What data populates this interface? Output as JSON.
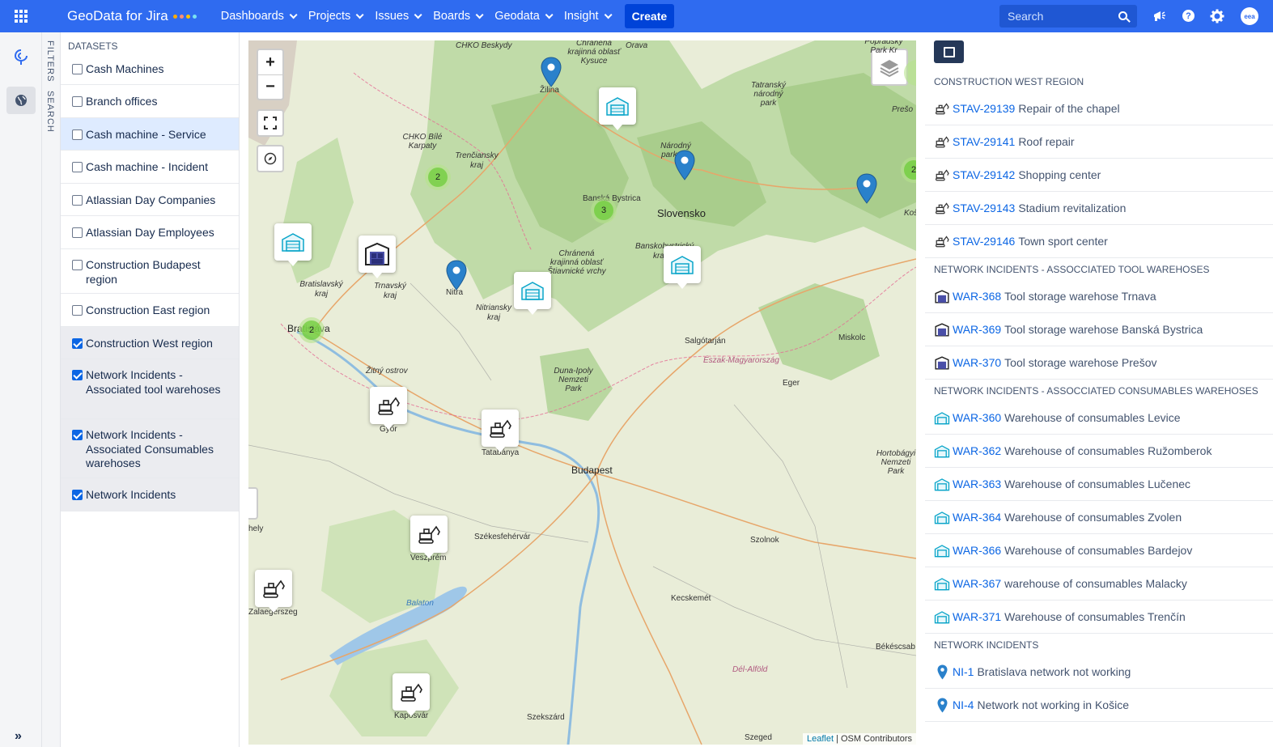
{
  "topbar": {
    "brand": "GeoData for Jira",
    "brand_dot_colors": [
      "#ffab00",
      "#ff8f73",
      "#ffc400",
      "#79e2f2"
    ],
    "nav": [
      {
        "label": "Dashboards"
      },
      {
        "label": "Projects"
      },
      {
        "label": "Issues"
      },
      {
        "label": "Boards"
      },
      {
        "label": "Geodata"
      },
      {
        "label": "Insight"
      }
    ],
    "create_label": "Create",
    "search_placeholder": "Search",
    "avatar_initials": "eea",
    "help_glyph": "?"
  },
  "vtabs": {
    "filters": "FILTERS",
    "search": "SEARCH"
  },
  "datasets": {
    "title": "DATASETS",
    "items": [
      {
        "label": "Cash Machines",
        "checked": false
      },
      {
        "label": "Branch offices",
        "checked": false
      },
      {
        "label": "Cash machine - Service",
        "checked": false
      },
      {
        "label": "Cash machine - Incident",
        "checked": false
      },
      {
        "label": "Atlassian Day Companies",
        "checked": false
      },
      {
        "label": "Atlassian Day Employees",
        "checked": false
      },
      {
        "label": "Construction Budapest region",
        "checked": false
      },
      {
        "label": "Construction East region",
        "checked": false
      },
      {
        "label": "Construction West region",
        "checked": true
      },
      {
        "label": "Network Incidents - Associated tool warehoses",
        "checked": true
      },
      {
        "label": "Network Incidents - Associated Consumables warehoses",
        "checked": true
      },
      {
        "label": "Network Incidents",
        "checked": true
      }
    ]
  },
  "map": {
    "zoom_in": "+",
    "zoom_out": "−",
    "labels": {
      "zilina": "Žilina",
      "orava": "Orava",
      "beskydy": "CHKO Beskydy",
      "kysuce": "Chránená krajinná oblasť Kysuce",
      "biele_karpaty": "CHKO Bílé Karpaty",
      "trenciansky": "Trenčiansky kraj",
      "banska": "Banská Bystrica",
      "slovensko": "Slovensko",
      "tatry": "Tatranský národný park",
      "presov": "Prešo",
      "nitra": "Nitra",
      "nitriansky": "Nitriansky kraj",
      "trnavsky": "Trnavský kraj",
      "bratislavsky": "Bratislavský kraj",
      "bratislava": "Bratislava",
      "stiavnicke": "Chránená krajinná oblasť Štiavnické vrchy",
      "banskobystricky": "Banskobystrický kraj",
      "salgotarjan": "Salgótarján",
      "eszak": "Észak-Magyarország",
      "miskolc": "Miskolc",
      "eger": "Eger",
      "zitny": "Žitný ostrov",
      "gyor": "Győr",
      "tatabanya": "Tatabánya",
      "budapest": "Budapest",
      "duna_ipoly": "Duna-Ipoly Nemzeti Park",
      "szekesfehervar": "Székesfehérvár",
      "veszprem": "Veszprém",
      "szolnok": "Szolnok",
      "zalaegerszeg": "Zalaegerszeg",
      "balaton": "Balaton",
      "kecskemet": "Kecskemét",
      "bekescsaba": "Békéscsab",
      "del_alfold": "Dél-Alföld",
      "kaposvar": "Kaposvár",
      "szekszard": "Szekszárd",
      "szeged": "Szeged",
      "hortobagy": "Hortobágyi Nemzeti Park",
      "poprad": "Popradský Park Kr",
      "kos": "Koš",
      "narodny_park": "Národný park Tat",
      "hely": "hely"
    },
    "clusters": [
      "2",
      "3",
      "2",
      "2"
    ],
    "attribution_link": "Leaflet",
    "attribution_text": " | OSM Contributors"
  },
  "results": {
    "sections": [
      {
        "title": "CONSTRUCTION WEST REGION",
        "icon": "excavator-icon",
        "items": [
          {
            "key": "STAV-29139",
            "summary": "Repair of the chapel"
          },
          {
            "key": "STAV-29141",
            "summary": "Roof repair"
          },
          {
            "key": "STAV-29142",
            "summary": "Shopping center"
          },
          {
            "key": "STAV-29143",
            "summary": "Stadium revitalization"
          },
          {
            "key": "STAV-29146",
            "summary": "Town sport center"
          }
        ]
      },
      {
        "title": "NETWORK INCIDENTS - ASSOCCIATED TOOL WAREHOSES",
        "icon": "tool-warehouse-icon",
        "items": [
          {
            "key": "WAR-368",
            "summary": "Tool storage warehose Trnava"
          },
          {
            "key": "WAR-369",
            "summary": "Tool storage warehose Banská Bystrica"
          },
          {
            "key": "WAR-370",
            "summary": "Tool storage warehose Prešov"
          }
        ]
      },
      {
        "title": "NETWORK INCIDENTS - ASSOCCIATED CONSUMABLES WAREHOSES",
        "icon": "consumables-warehouse-icon",
        "items": [
          {
            "key": "WAR-360",
            "summary": "Warehouse of consumables Levice"
          },
          {
            "key": "WAR-362",
            "summary": "Warehouse of consumables Ružomberok"
          },
          {
            "key": "WAR-363",
            "summary": "Warehouse of consumables Lučenec"
          },
          {
            "key": "WAR-364",
            "summary": "Warehouse of consumables Zvolen"
          },
          {
            "key": "WAR-366",
            "summary": "Warehouse of consumables Bardejov"
          },
          {
            "key": "WAR-367",
            "summary": "warehouse of consumables Malacky"
          },
          {
            "key": "WAR-371",
            "summary": "Warehouse of consumables Trenčín"
          }
        ]
      },
      {
        "title": "NETWORK INCIDENTS",
        "icon": "map-pin-icon",
        "items": [
          {
            "key": "NI-1",
            "summary": "Bratislava network not working"
          },
          {
            "key": "NI-4",
            "summary": "Network not working in Košice"
          }
        ]
      }
    ]
  },
  "colors": {
    "topbar": "#2f6bf0",
    "link": "#0c66e4",
    "pin": "#2a81cb",
    "cluster": "#6ecc39",
    "consumables": "#0aa5c9"
  }
}
